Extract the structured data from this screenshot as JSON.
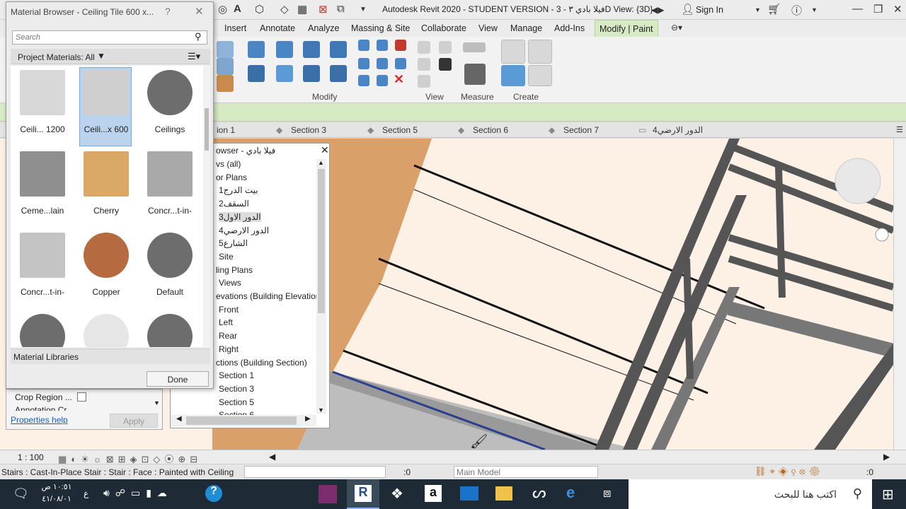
{
  "app": {
    "title": "Autodesk Revit 2020 - STUDENT VERSION - فيلا بادي ٣ - 3D View: {3D}",
    "sign_in": "Sign In"
  },
  "ribbon_tabs": [
    "Insert",
    "Annotate",
    "Analyze",
    "Massing & Site",
    "Collaborate",
    "View",
    "Manage",
    "Add-Ins",
    "Modify | Paint"
  ],
  "ribbon_panels": {
    "modify": "Modify",
    "view": "View",
    "measure": "Measure",
    "create": "Create"
  },
  "view_tabs": [
    "ion 1",
    "Section 3",
    "Section 5",
    "Section 6",
    "Section 7",
    "4الدور الارضي"
  ],
  "material_browser": {
    "title": "Material Browser - Ceiling Tile 600 x...",
    "help": "?",
    "close": "✕",
    "search_placeholder": "Search",
    "filter_label": "Project Materials: All",
    "tiles": [
      {
        "label": "Ceili... 1200",
        "color": "#d8d8d8"
      },
      {
        "label": "Ceili...x 600",
        "color": "#cfcfcf"
      },
      {
        "label": "Ceilings",
        "color": "#6d6d6d"
      },
      {
        "label": "Ceme...lain",
        "color": "#8f8f8f"
      },
      {
        "label": "Cherry",
        "color": "#d9a866"
      },
      {
        "label": "Concr...t-in-",
        "color": "#a9a9a9"
      },
      {
        "label": "Concr...t-in-",
        "color": "#c4c4c4"
      },
      {
        "label": "Copper",
        "color": "#b56a3f"
      },
      {
        "label": "Default",
        "color": "#6d6d6d"
      }
    ],
    "libraries": "Material Libraries",
    "done": "Done"
  },
  "properties": {
    "row1": "Crop Region ...",
    "row2": "Annotation Cr...",
    "help": "Properties help",
    "apply": "Apply"
  },
  "project_browser": {
    "title": "owser - فيلا بادي",
    "rows": [
      "vs (all)",
      "or Plans",
      "1بيت الدرج",
      "2السقف",
      "3الدور الاول",
      "4الدور الارضي",
      "5الشارع",
      "Site",
      "ling Plans",
      "Views",
      "evations (Building Elevation",
      "Front",
      "Left",
      "Rear",
      "Right",
      "ctions (Building Section)",
      "Section 1",
      "Section 3",
      "Section 5",
      "Section 6"
    ]
  },
  "viewbar": {
    "scale": "1 : 100"
  },
  "status": {
    "text": "Stairs : Cast-In-Place Stair : Stair : Face : Painted with Ceiling",
    "zero1": ":0",
    "model": "Main Model",
    "zero2": ":0"
  },
  "taskbar": {
    "time": "١٠:٥١ ص",
    "date": "٤١/٠٨/٠١",
    "lang": "ع",
    "search": "اكتب هنا للبحث"
  }
}
